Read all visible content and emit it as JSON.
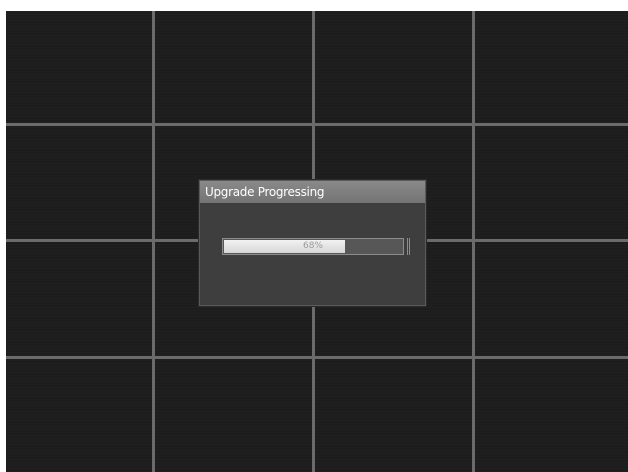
{
  "dialog": {
    "title": "Upgrade Progressing",
    "progress": {
      "fraction": 0.68,
      "label": "68%"
    }
  },
  "colors": {
    "screen_background": "#1b1b1b",
    "grid_lines": "#6b6b6b",
    "title_bar": "#7e7e7e",
    "dialog_body": "#3e3e3e",
    "progress_fill": "#e6e6e6"
  }
}
